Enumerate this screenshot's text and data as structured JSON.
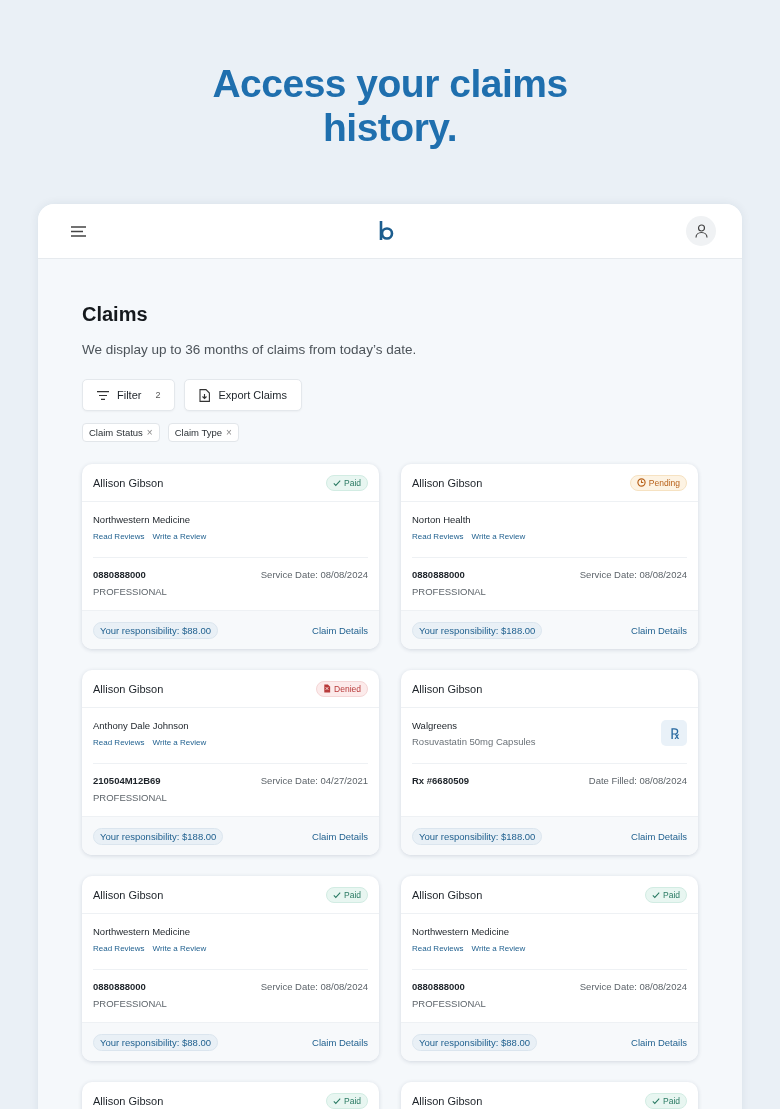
{
  "headline": "Access your claims history.",
  "page": {
    "title": "Claims",
    "subtitle": "We display up to 36 months of claims from today’s date."
  },
  "toolbar": {
    "filter": {
      "label": "Filter",
      "count": "2"
    },
    "export": {
      "label": "Export Claims"
    }
  },
  "filter_chips": [
    {
      "label": "Claim Status",
      "remove": "×"
    },
    {
      "label": "Claim Type",
      "remove": "×"
    }
  ],
  "claims": [
    {
      "kind": "medical",
      "patient": "Allison Gibson",
      "status": {
        "kind": "paid",
        "label": "Paid"
      },
      "provider": "Northwestern Medicine",
      "links": [
        "Read Reviews",
        "Write a Review"
      ],
      "claim_id": "0880888000",
      "claim_type": "PROFESSIONAL",
      "date": "Service Date: 08/08/2024",
      "responsibility": "Your responsibility: $88.00",
      "details": "Claim Details"
    },
    {
      "kind": "medical",
      "patient": "Allison Gibson",
      "status": {
        "kind": "pending",
        "label": "Pending"
      },
      "provider": "Norton Health",
      "links": [
        "Read Reviews",
        "Write a Review"
      ],
      "claim_id": "0880888000",
      "claim_type": "PROFESSIONAL",
      "date": "Service Date: 08/08/2024",
      "responsibility": "Your responsibility: $188.00",
      "details": "Claim Details"
    },
    {
      "kind": "medical",
      "patient": "Allison Gibson",
      "status": {
        "kind": "denied",
        "label": "Denied"
      },
      "provider": "Anthony Dale Johnson",
      "links": [
        "Read Reviews",
        "Write a Review"
      ],
      "claim_id": "210504M12B69",
      "claim_type": "PROFESSIONAL",
      "date": "Service Date: 04/27/2021",
      "responsibility": "Your responsibility: $188.00",
      "details": "Claim Details"
    },
    {
      "kind": "pharmacy",
      "patient": "Allison Gibson",
      "provider": "Walgreens",
      "drug": "Rosuvastatin 50mg Capsules",
      "rx_symbol": "℞",
      "claim_id": "Rx #6680509",
      "date": "Date Filled: 08/08/2024",
      "responsibility": "Your responsibility: $188.00",
      "details": "Claim Details"
    },
    {
      "kind": "medical",
      "patient": "Allison Gibson",
      "status": {
        "kind": "paid",
        "label": "Paid"
      },
      "provider": "Northwestern Medicine",
      "links": [
        "Read Reviews",
        "Write a Review"
      ],
      "claim_id": "0880888000",
      "claim_type": "PROFESSIONAL",
      "date": "Service Date: 08/08/2024",
      "responsibility": "Your responsibility: $88.00",
      "details": "Claim Details"
    },
    {
      "kind": "medical",
      "patient": "Allison Gibson",
      "status": {
        "kind": "paid",
        "label": "Paid"
      },
      "provider": "Northwestern Medicine",
      "links": [
        "Read Reviews",
        "Write a Review"
      ],
      "claim_id": "0880888000",
      "claim_type": "PROFESSIONAL",
      "date": "Service Date: 08/08/2024",
      "responsibility": "Your responsibility: $88.00",
      "details": "Claim Details"
    },
    {
      "kind": "medical",
      "patient": "Allison Gibson",
      "status": {
        "kind": "paid",
        "label": "Paid"
      }
    },
    {
      "kind": "medical",
      "patient": "Allison Gibson",
      "status": {
        "kind": "paid",
        "label": "Paid"
      }
    }
  ]
}
